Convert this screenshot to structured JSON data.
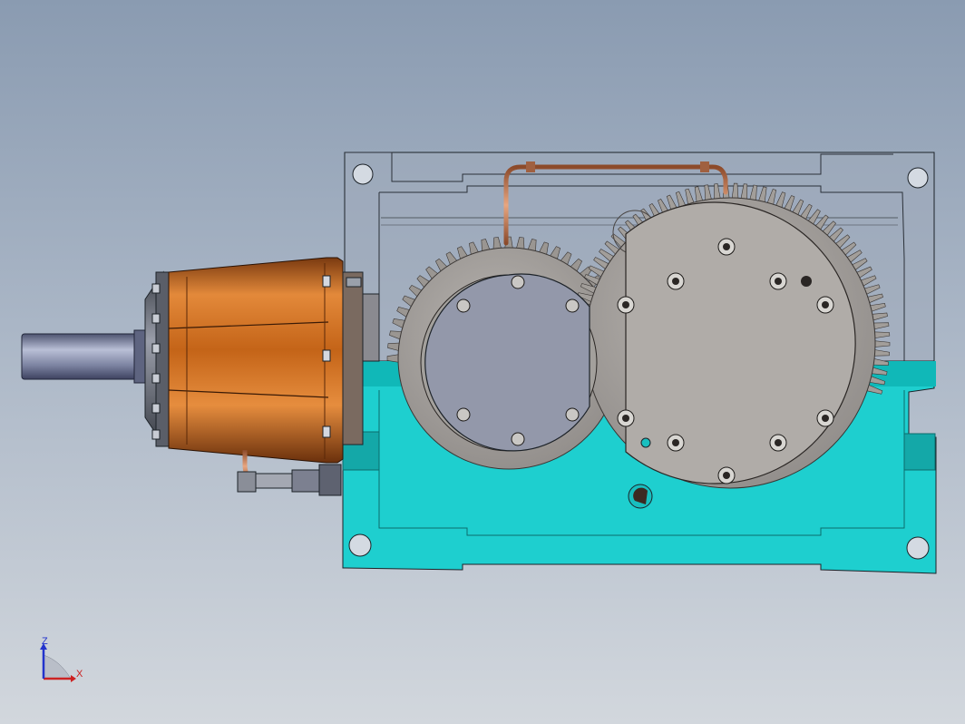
{
  "colors": {
    "background_top": "#8a9bb1",
    "background_bottom": "#d2d7dd",
    "housing_cyan": "#1ecfcf",
    "housing_glass": "#9eaab9",
    "motor_orange": "#c9661c",
    "shaft_steel": "#7c8299",
    "gear_gray": "#a6a29f",
    "cover_plate": "#9398aa",
    "oil_pipe": "#c07850",
    "outline": "#1c2228"
  },
  "triad": {
    "x_label": "X",
    "z_label": "Z",
    "x_color": "#cc2222",
    "z_color": "#2233cc"
  }
}
